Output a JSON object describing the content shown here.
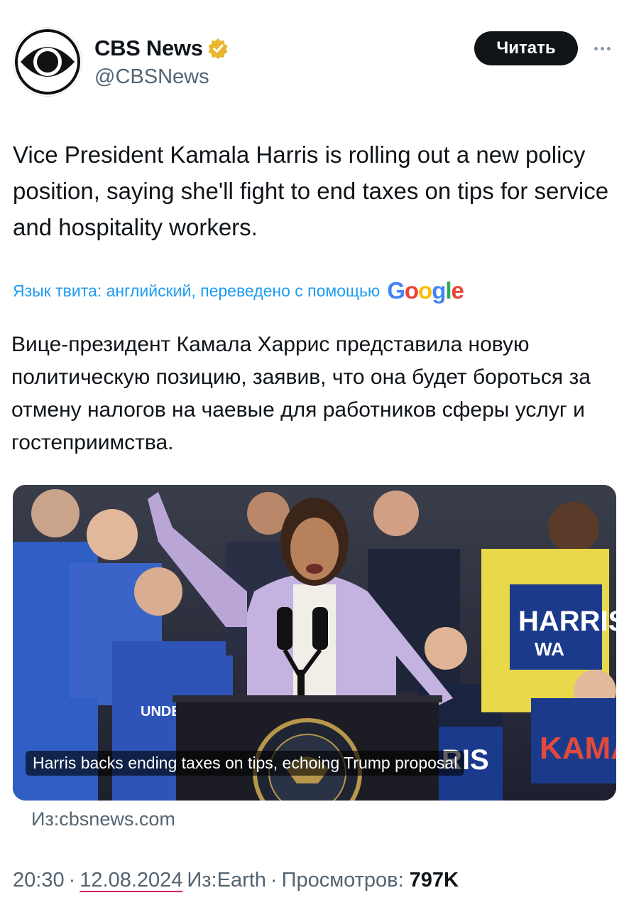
{
  "account": {
    "display_name": "CBS News",
    "handle": "@CBSNews",
    "verified": true,
    "badge_color": "#e8b72f",
    "avatar_icon": "cbs-eye-logo-icon"
  },
  "actions": {
    "follow_label": "Читать",
    "more_icon": "more-dots-icon"
  },
  "tweet": {
    "text": "Vice President Kamala Harris is rolling out a new policy position, saying she'll fight to end taxes on tips for service and hospitality workers."
  },
  "translation": {
    "note": "Язык твита: английский, переведено с помощью",
    "provider_letters": [
      "G",
      "o",
      "o",
      "g",
      "l",
      "e"
    ],
    "text": "Вице-президент Камала Харрис представила новую политическую позицию, заявив, что она будет бороться за отмену налогов на чаевые для работников сферы услуг и гостеприимства."
  },
  "card": {
    "caption": "Harris backs ending taxes on tips, echoing Trump proposal",
    "sign_harris": "HARRIS",
    "sign_harris_sub": "WA",
    "sign_kama": "KAMA",
    "sign_ris": "RIS",
    "shirt_text": "UNDE"
  },
  "source": {
    "text": "Из:cbsnews.com"
  },
  "meta": {
    "time": "20:30",
    "separator": "·",
    "date": "12.08.2024",
    "location": "Из:Earth",
    "views_label": "Просмотров:",
    "views_count": "797K"
  },
  "colors": {
    "link": "#1d9bf0",
    "secondary_text": "#536471",
    "primary_text": "#0f1419",
    "button_bg": "#0f1419",
    "date_underline": "#e0245e"
  }
}
